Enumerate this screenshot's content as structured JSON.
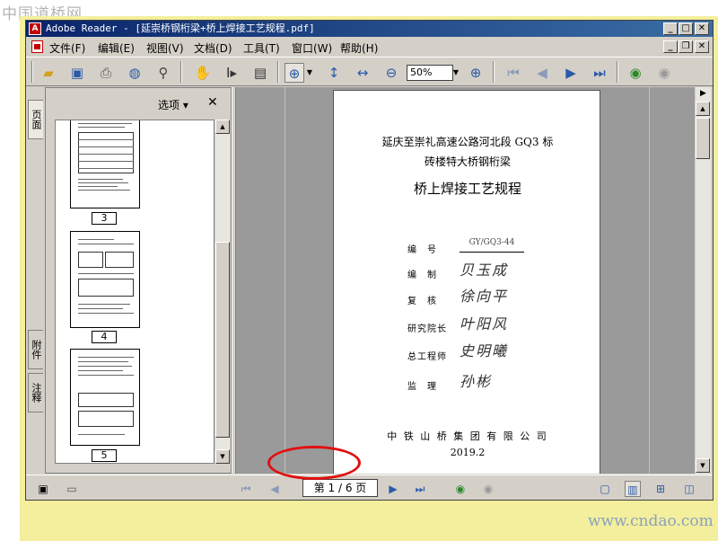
{
  "watermark": {
    "top": "中国道桥网",
    "bottom": "www.cndao.com"
  },
  "window": {
    "title": "Adobe Reader - [延崇桥钢桁梁+桥上焊接工艺规程.pdf]",
    "controls": {
      "minimize": "_",
      "maximize": "□",
      "close": "✕",
      "doc_minimize": "_",
      "doc_restore": "❐",
      "doc_close": "✕"
    }
  },
  "menu": {
    "items": [
      "文件(F)",
      "编辑(E)",
      "视图(V)",
      "文档(D)",
      "工具(T)",
      "窗口(W)",
      "帮助(H)"
    ]
  },
  "toolbar": {
    "zoom_value": "50%",
    "icons": [
      "open-icon",
      "save-icon",
      "print-icon",
      "email-icon",
      "search-icon",
      "hand-icon",
      "select-text-icon",
      "snapshot-icon",
      "zoom-in-icon",
      "fit-height-icon",
      "fit-width-icon",
      "zoom-out-minus-icon",
      "zoom-plus-icon",
      "first-page-icon",
      "prev-page-icon",
      "next-page-icon",
      "last-page-icon",
      "go-back-icon",
      "go-forward-icon"
    ]
  },
  "side_tabs": {
    "pages": "页面",
    "attachments": "附件",
    "comments": "注释"
  },
  "panel": {
    "options_label": "选项 ▾",
    "close_label": "✕",
    "thumbnails": [
      {
        "number": "3"
      },
      {
        "number": "4"
      },
      {
        "number": "5"
      }
    ]
  },
  "document": {
    "line1": "延庆至崇礼高速公路河北段 GQ3 标",
    "line2": "砖楼特大桥钢桁梁",
    "title": "桥上焊接工艺规程",
    "fields": [
      {
        "label": "编　号",
        "value": "GY/GQ3-44"
      },
      {
        "label": "编　制",
        "value": "贝玉成"
      },
      {
        "label": "复　核",
        "value": "徐向平"
      },
      {
        "label": "研究院长",
        "value": "叶阳风"
      },
      {
        "label": "总工程师",
        "value": "史明曦"
      },
      {
        "label": "监　理",
        "value": "孙彬"
      }
    ],
    "company": "中 铁 山 桥 集 团 有 限 公 司",
    "date": "2019.2"
  },
  "status": {
    "page_indicator": "第 1 / 6 页"
  }
}
